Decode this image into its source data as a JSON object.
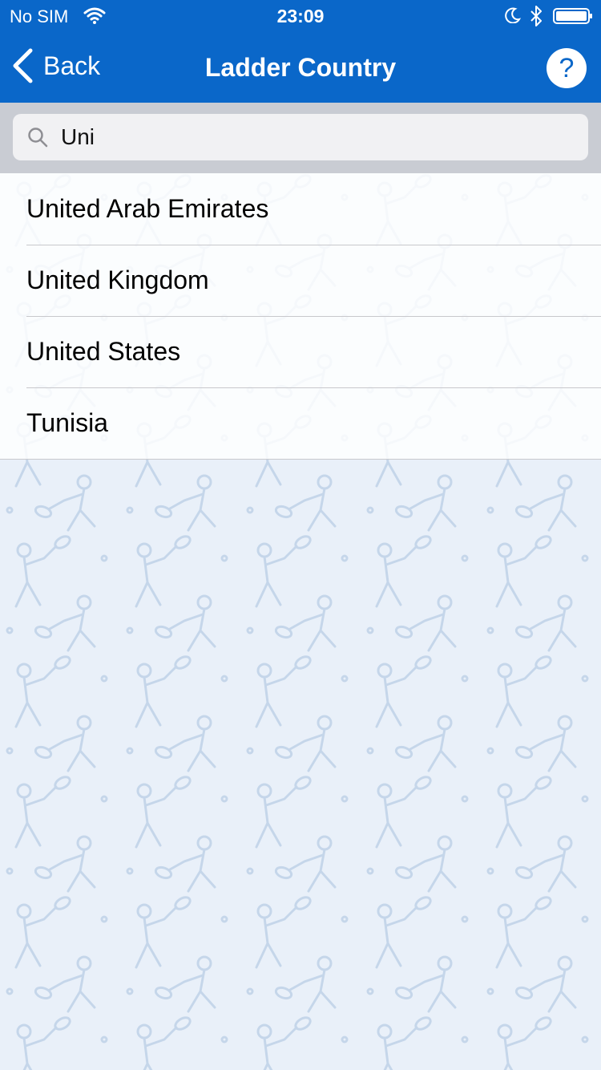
{
  "status": {
    "carrier": "No SIM",
    "time": "23:09"
  },
  "nav": {
    "back_label": "Back",
    "title": "Ladder Country",
    "help_symbol": "?"
  },
  "search": {
    "value": "Uni"
  },
  "countries": [
    {
      "name": "United Arab Emirates"
    },
    {
      "name": "United Kingdom"
    },
    {
      "name": "United States"
    },
    {
      "name": "Tunisia"
    }
  ],
  "colors": {
    "nav_bar": "#0a67c9",
    "background": "#e9f0f9",
    "pattern": "#c5d6ea"
  },
  "icons": {
    "back": "chevron-left-icon",
    "help": "question-circle-icon",
    "search": "magnifier-icon",
    "wifi": "wifi-icon",
    "moon": "moon-icon",
    "bluetooth": "bluetooth-icon",
    "battery": "battery-icon"
  }
}
